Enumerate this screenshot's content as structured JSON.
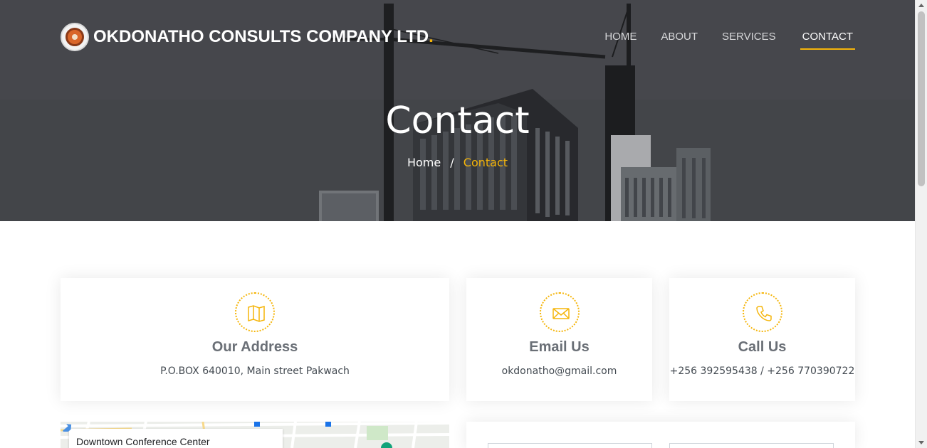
{
  "brand": {
    "name": "OKDONATHO CONSULTS COMPANY LTD",
    "dot": "."
  },
  "nav": {
    "items": [
      {
        "label": "HOME"
      },
      {
        "label": "ABOUT"
      },
      {
        "label": "SERVICES"
      },
      {
        "label": "CONTACT",
        "active": true
      }
    ]
  },
  "hero": {
    "title": "Contact",
    "breadcrumb": {
      "home": "Home",
      "separator": "/",
      "current": "Contact"
    }
  },
  "cards": {
    "address": {
      "icon": "map-icon",
      "title": "Our Address",
      "text": "P.O.BOX 640010, Main street Pakwach"
    },
    "email": {
      "icon": "envelope-icon",
      "title": "Email Us",
      "text": "okdonatho@gmail.com"
    },
    "call": {
      "icon": "phone-icon",
      "title": "Call Us",
      "text": "+256 392595438 / +256 770390722"
    }
  },
  "map": {
    "place_name": "Downtown Conference Center"
  },
  "colors": {
    "accent": "#f5b50a",
    "heading": "#6a6f76",
    "text": "#444b52"
  }
}
